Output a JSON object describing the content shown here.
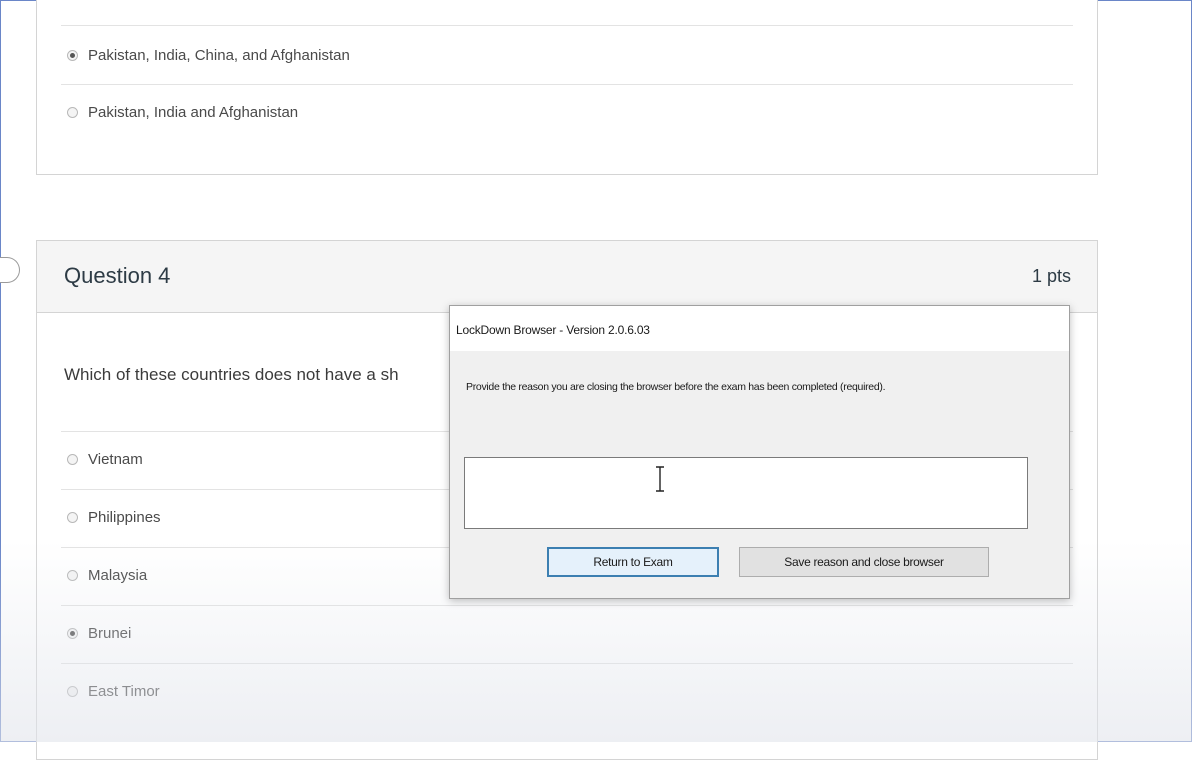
{
  "previous_question": {
    "answers": [
      {
        "label": "Pakistan, India, China, and Afghanistan",
        "selected": true
      },
      {
        "label": "Pakistan, India and Afghanistan",
        "selected": false
      }
    ]
  },
  "question": {
    "title": "Question 4",
    "points": "1 pts",
    "text": "Which of these countries does not have a sh",
    "answers": [
      {
        "label": "Vietnam",
        "selected": false
      },
      {
        "label": "Philippines",
        "selected": false
      },
      {
        "label": "Malaysia",
        "selected": false
      },
      {
        "label": "Brunei",
        "selected": true
      },
      {
        "label": "East Timor",
        "selected": false
      }
    ]
  },
  "dialog": {
    "title": "LockDown Browser - Version 2.0.6.03",
    "message": "Provide the reason you are closing the browser before the exam has been completed (required).",
    "reason_value": "",
    "return_button": "Return to Exam",
    "close_button": "Save reason and close browser"
  },
  "colors": {
    "frame_border": "#6a86c8",
    "header_bg": "#f5f5f5",
    "dialog_bg": "#f0f0f0",
    "primary_button_border": "#3c7fb1"
  }
}
